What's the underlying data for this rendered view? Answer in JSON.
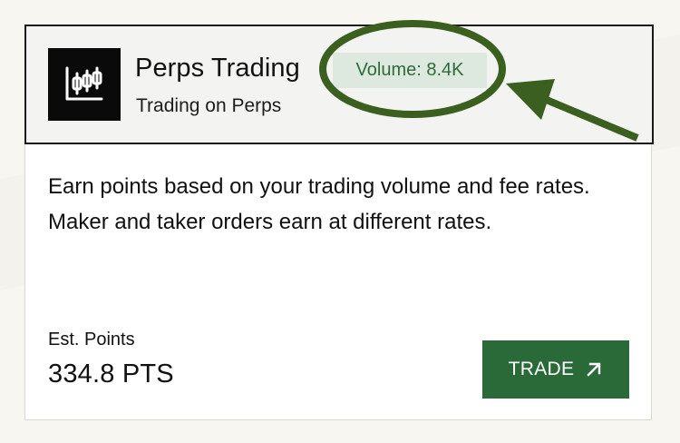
{
  "card": {
    "logo_icon": "candlestick-chart-icon",
    "title": "Perps Trading",
    "subtitle": "Trading on Perps",
    "volume_badge": "Volume: 8.4K",
    "description": "Earn points based on your trading volume and fee rates. Maker and taker orders earn at different rates.",
    "est_points_label": "Est. Points",
    "est_points_value": "334.8 PTS",
    "trade_button_label": "TRADE",
    "trade_button_icon": "arrow-up-right-icon"
  },
  "annotation": {
    "shape": "ellipse-highlight-with-arrow",
    "color": "#3b5f1f"
  },
  "colors": {
    "accent_green": "#2a6a38",
    "badge_bg": "#dde8df",
    "badge_text": "#2f6b3a",
    "header_bg": "#f3f3f1"
  }
}
